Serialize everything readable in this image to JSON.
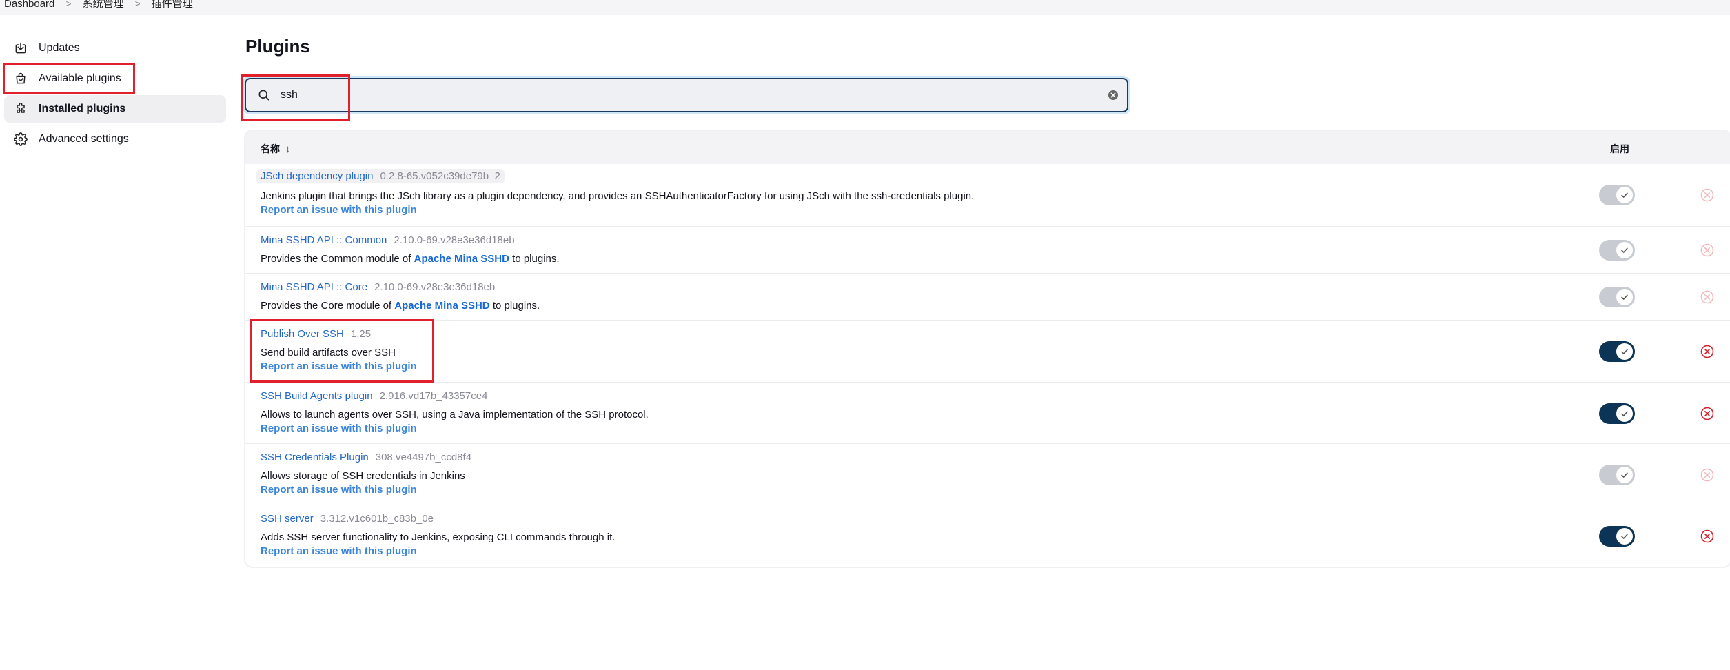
{
  "breadcrumb": {
    "items": [
      "Dashboard",
      "系统管理",
      "插件管理"
    ],
    "separator": ">"
  },
  "sidebar": {
    "items": [
      {
        "label": "Updates",
        "icon": "download-icon"
      },
      {
        "label": "Available plugins",
        "icon": "shopping-bag-icon"
      },
      {
        "label": "Installed plugins",
        "icon": "puzzle-icon"
      },
      {
        "label": "Advanced settings",
        "icon": "gear-icon"
      }
    ],
    "active_index": 2
  },
  "page": {
    "title": "Plugins"
  },
  "search": {
    "value": "ssh",
    "placeholder": ""
  },
  "table": {
    "columns": {
      "name": "名称",
      "sort_arrow": "↓",
      "enabled": "启用"
    },
    "report_label": "Report an issue with this plugin",
    "rows": [
      {
        "name": "JSch dependency plugin",
        "version": "0.2.8-65.v052c39de79b_2",
        "desc": "Jenkins plugin that brings the JSch library as a plugin dependency, and provides an SSHAuthenticatorFactory for using JSch with the ssh-credentials plugin.",
        "desc_pre": "",
        "desc_link": "",
        "desc_post": "",
        "has_report": true,
        "enabled": false
      },
      {
        "name": "Mina SSHD API :: Common",
        "version": "2.10.0-69.v28e3e36d18eb_",
        "desc": "",
        "desc_pre": "Provides the Common module of ",
        "desc_link": "Apache Mina SSHD",
        "desc_post": " to plugins.",
        "has_report": false,
        "enabled": false
      },
      {
        "name": "Mina SSHD API :: Core",
        "version": "2.10.0-69.v28e3e36d18eb_",
        "desc": "",
        "desc_pre": "Provides the Core module of ",
        "desc_link": "Apache Mina SSHD",
        "desc_post": " to plugins.",
        "has_report": false,
        "enabled": false
      },
      {
        "name": "Publish Over SSH",
        "version": "1.25",
        "desc": "Send build artifacts over SSH",
        "desc_pre": "",
        "desc_link": "",
        "desc_post": "",
        "has_report": true,
        "enabled": true
      },
      {
        "name": "SSH Build Agents plugin",
        "version": "2.916.vd17b_43357ce4",
        "desc": "Allows to launch agents over SSH, using a Java implementation of the SSH protocol.",
        "desc_pre": "",
        "desc_link": "",
        "desc_post": "",
        "has_report": true,
        "enabled": true
      },
      {
        "name": "SSH Credentials Plugin",
        "version": "308.ve4497b_ccd8f4",
        "desc": "Allows storage of SSH credentials in Jenkins",
        "desc_pre": "",
        "desc_link": "",
        "desc_post": "",
        "has_report": true,
        "enabled": false
      },
      {
        "name": "SSH server",
        "version": "3.312.v1c601b_c83b_0e",
        "desc": "Adds SSH server functionality to Jenkins, exposing CLI commands through it.",
        "desc_pre": "",
        "desc_link": "",
        "desc_post": "",
        "has_report": true,
        "enabled": true
      }
    ]
  },
  "colors": {
    "link": "#2469c5",
    "toggle_on": "#0c3456",
    "toggle_off": "#c8ccd2",
    "uninstall_active": "#d4202c",
    "uninstall_disabled": "#f2b8bc",
    "highlight_box": "#e0202a"
  }
}
